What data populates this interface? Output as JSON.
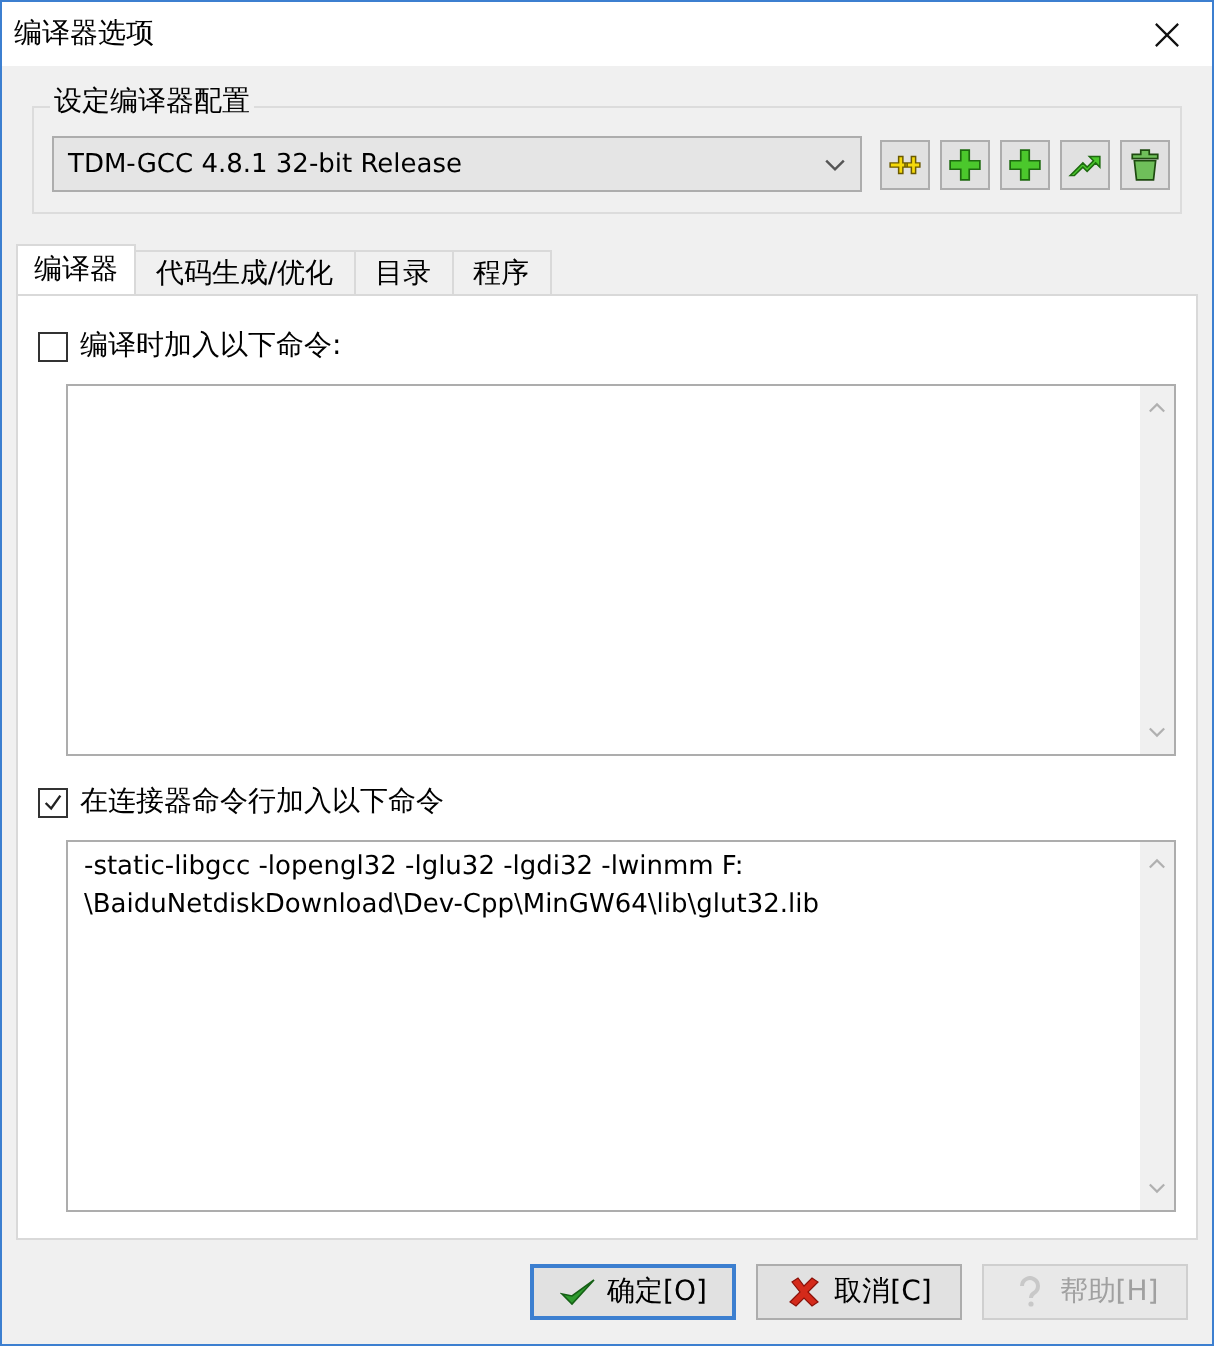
{
  "window": {
    "title": "编译器选项"
  },
  "config": {
    "label": "设定编译器配置",
    "value": "TDM-GCC 4.8.1 32-bit Release"
  },
  "tabs": [
    {
      "label": "编译器",
      "selected": true
    },
    {
      "label": "代码生成/优化",
      "selected": false
    },
    {
      "label": "目录",
      "selected": false
    },
    {
      "label": "程序",
      "selected": false
    }
  ],
  "options": [
    {
      "label": "编译时加入以下命令:",
      "checked": false
    },
    {
      "label": "在连接器命令行加入以下命令",
      "checked": true,
      "lines": [
        "-static-libgcc  -lopengl32  -lglu32 -lgdi32  -lwinmm F:",
        "\\BaiduNetdiskDownload\\Dev-Cpp\\MinGW64\\lib\\glut32.lib"
      ]
    }
  ],
  "buttons": [
    {
      "label": "确定[O]",
      "kind": "ok",
      "disabled": false
    },
    {
      "label": "取消[C]",
      "kind": "cancel",
      "disabled": false
    },
    {
      "label": "帮助[H]",
      "kind": "help",
      "disabled": true
    }
  ]
}
